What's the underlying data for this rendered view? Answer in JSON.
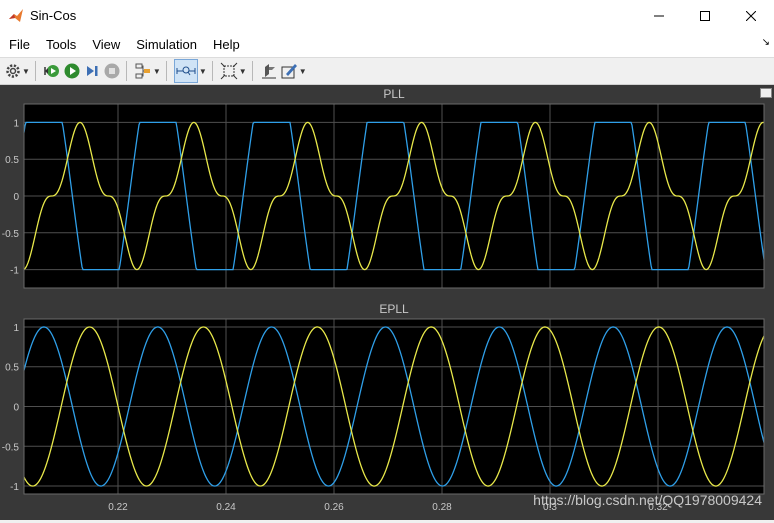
{
  "window": {
    "title": "Sin-Cos"
  },
  "menu": [
    "File",
    "Tools",
    "View",
    "Simulation",
    "Help"
  ],
  "toolbar_icons": [
    "settings-icon",
    "run-back-icon",
    "run-icon",
    "step-forward-icon",
    "stop-icon",
    "signal-selector-icon",
    "zoom-icon",
    "fit-axes-icon",
    "highlight-icon",
    "style-icon"
  ],
  "colors": {
    "background": "#000000",
    "frame": "#383838",
    "grid": "#4f4f4f",
    "tick_text": "#c8c8c8",
    "title_text": "#c8c8c8",
    "series1": "#2f9fe8",
    "series2": "#e8e84a"
  },
  "chart_data": [
    {
      "type": "line",
      "title": "PLL",
      "xlim": [
        0.2,
        0.33
      ],
      "ylim": [
        -1.25,
        1.25
      ],
      "yticks": [
        "1",
        "0.5",
        "0",
        "-0.5",
        "-1"
      ],
      "grid": true,
      "series": [
        {
          "shape": "clipped-sine",
          "amplitude": 1,
          "period": 0.02,
          "note": "square-like"
        },
        {
          "shape": "cusp-wave",
          "amplitude": 1,
          "period": 0.02
        }
      ]
    },
    {
      "type": "line",
      "title": "EPLL",
      "xlim": [
        0.2,
        0.33
      ],
      "ylim": [
        -1.1,
        1.1
      ],
      "yticks": [
        "1",
        "0.5",
        "0",
        "-0.5",
        "-1"
      ],
      "xticks": [
        "0.22",
        "0.24",
        "0.26",
        "0.28",
        "0.3",
        "0.32"
      ],
      "grid": true,
      "series": [
        {
          "shape": "sine",
          "amplitude": 1,
          "period": 0.02
        },
        {
          "shape": "sine",
          "amplitude": 1,
          "period": 0.02
        }
      ]
    }
  ],
  "watermark": "https://blog.csdn.net/QQ1978009424"
}
